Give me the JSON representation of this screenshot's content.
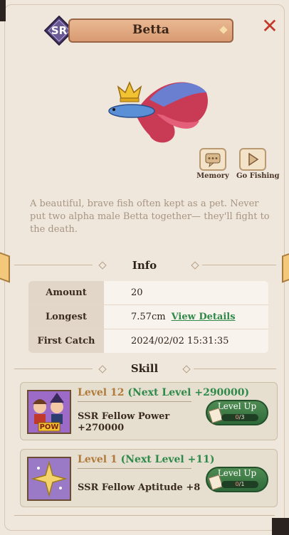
{
  "header": {
    "rarity": "SR",
    "fish_name": "Betta",
    "close_icon": "close-x-icon"
  },
  "actions": {
    "memory_label": "Memory",
    "go_fishing_label": "Go Fishing"
  },
  "description": "A beautiful, brave fish often kept as a pet. Never put two alpha male Betta together— they'll fight to the death.",
  "info": {
    "title": "Info",
    "rows": [
      {
        "label": "Amount",
        "value": "20"
      },
      {
        "label": "Longest",
        "value": "7.57cm",
        "link": "View Details"
      },
      {
        "label": "First Catch",
        "value": "2024/02/02 15:31:35"
      }
    ]
  },
  "skill": {
    "title": "Skill",
    "items": [
      {
        "level": "Level 12",
        "next": "(Next Level +290000)",
        "desc_line1": "SSR Fellow Power",
        "desc_line2": "+270000",
        "icon_badge": "POW",
        "button_label": "Level Up",
        "progress_current": "0",
        "progress_total": "/3"
      },
      {
        "level": "Level 1",
        "next": "(Next Level +11)",
        "desc_line1": "SSR Fellow Aptitude +8",
        "button_label": "Level Up",
        "progress_current": "0",
        "progress_total": "/1"
      }
    ]
  },
  "colors": {
    "panel": "#efe7dc",
    "accent_green": "#2f8a4a",
    "level_gold": "#b07a3a",
    "close_red": "#c0392b"
  }
}
